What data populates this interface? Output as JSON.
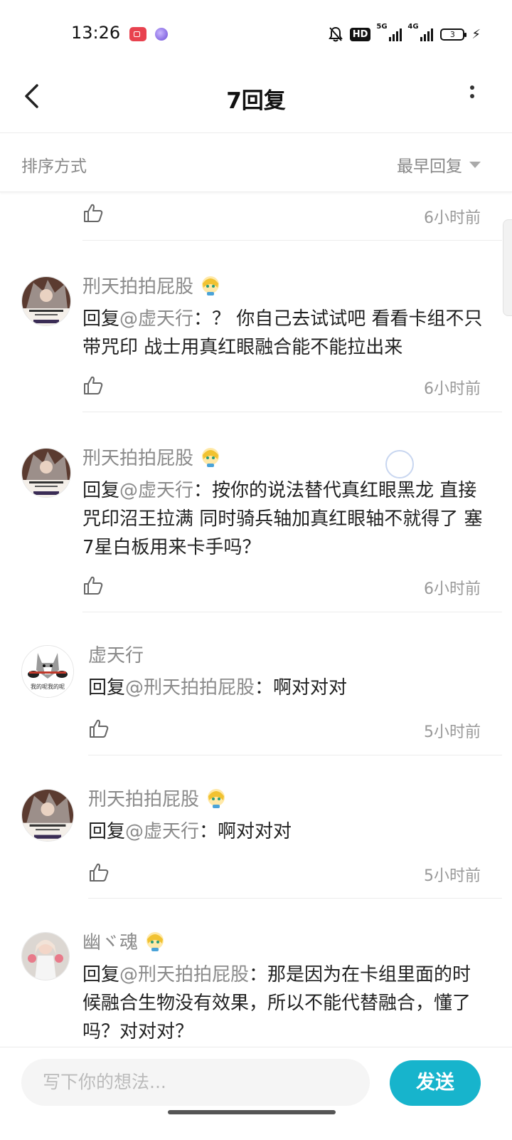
{
  "status_bar": {
    "time": "13:26",
    "hd_label": "HD",
    "sim1_label": "5G",
    "sim2_label": "4G",
    "battery_level": "3"
  },
  "header": {
    "title": "7回复"
  },
  "sort": {
    "label": "排序方式",
    "selected": "最早回复"
  },
  "comments": [
    {
      "author": "",
      "reply_prefix": "",
      "mention": "",
      "text": "",
      "time": "6小时前",
      "avatar": "none",
      "partial": true
    },
    {
      "author": "刑天拍拍屁股",
      "reply_prefix": "回复",
      "mention": "@虚天行",
      "text": "：？ 你自己去试试吧 看看卡组不只带咒印 战士用真红眼融合能不能拉出来",
      "time": "6小时前",
      "avatar": "anime-character-avatar",
      "has_badge": true
    },
    {
      "author": "刑天拍拍屁股",
      "reply_prefix": "回复",
      "mention": "@虚天行",
      "text": "：按你的说法替代真红眼黑龙 直接咒印沼王拉满 同时骑兵轴加真红眼轴不就得了 塞7星白板用来卡手吗？",
      "time": "6小时前",
      "avatar": "anime-character-avatar",
      "has_badge": true
    },
    {
      "author": "虚天行",
      "reply_prefix": "回复",
      "mention": "@刑天拍拍屁股",
      "text": "：啊对对对",
      "time": "5小时前",
      "avatar": "husky-dog-avatar",
      "avatar_caption": "我的呢我的呢",
      "has_badge": false
    },
    {
      "author": "刑天拍拍屁股",
      "reply_prefix": "回复",
      "mention": "@虚天行",
      "text": "：啊对对对",
      "time": "5小时前",
      "avatar": "anime-character-avatar",
      "has_badge": true
    },
    {
      "author": "幽ヾ魂",
      "reply_prefix": "回复",
      "mention": "@刑天拍拍屁股",
      "text": "：那是因为在卡组里面的时候融合生物没有效果，所以不能代替融合，懂了吗？对对对？",
      "time": "",
      "avatar": "figure-photo-avatar",
      "has_badge": true
    }
  ],
  "composer": {
    "placeholder": "写下你的想法...",
    "send_label": "发送"
  },
  "colors": {
    "accent": "#17b4cc",
    "muted_text": "#8a8a8a",
    "divider": "#ececec"
  }
}
